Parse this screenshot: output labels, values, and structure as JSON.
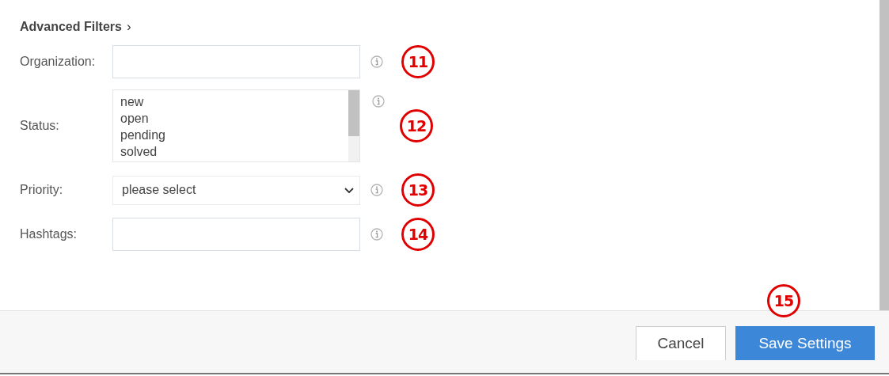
{
  "section": {
    "title": "Advanced Filters",
    "chevron": "›"
  },
  "fields": [
    {
      "kind": "text",
      "label": "Organization:",
      "callout": "11"
    },
    {
      "kind": "listbox",
      "label": "Status:",
      "options": [
        "new",
        "open",
        "pending",
        "solved"
      ],
      "callout": "12"
    },
    {
      "kind": "select",
      "label": "Priority:",
      "value": "please select",
      "callout": "13"
    },
    {
      "kind": "text",
      "label": "Hashtags:",
      "callout": "14"
    }
  ],
  "footer": {
    "buttons": [
      {
        "kind": "secondary",
        "label": "Cancel"
      },
      {
        "kind": "primary",
        "label": "Save Settings",
        "callout": "15"
      }
    ]
  }
}
